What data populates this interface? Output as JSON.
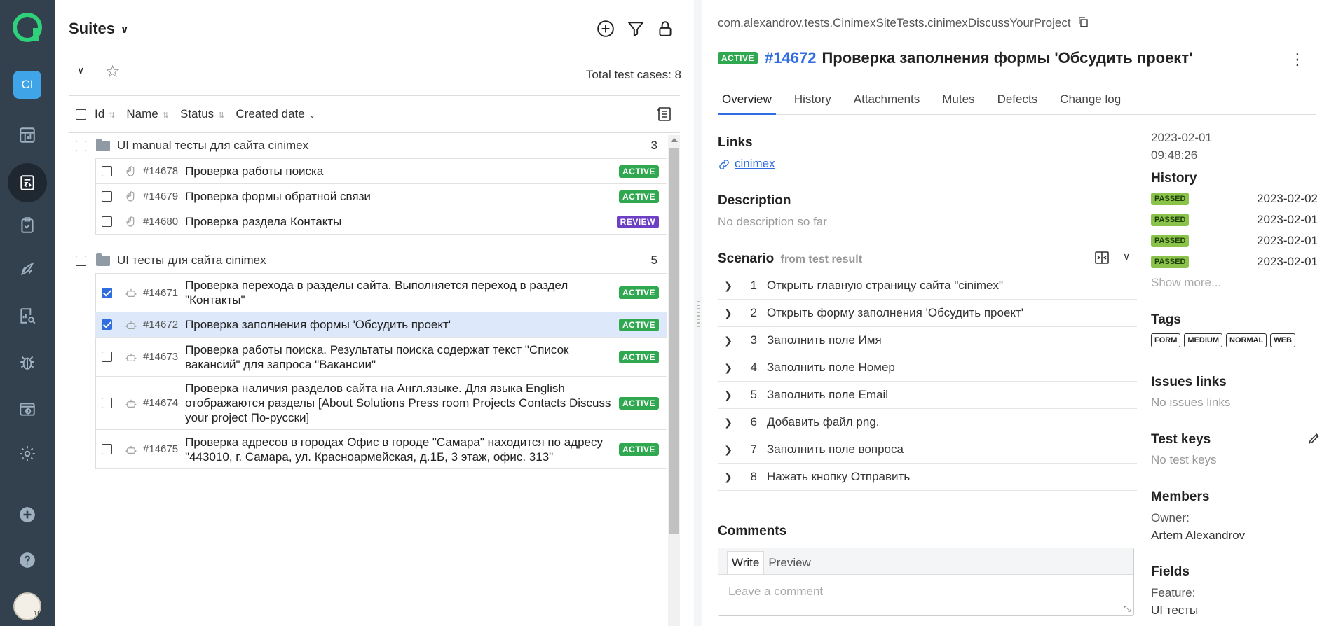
{
  "rail": {
    "project_badge": "CI",
    "avatar_badge": "10"
  },
  "suites": {
    "title": "Suites",
    "total": "Total test cases: 8",
    "columns": {
      "id": "Id",
      "name": "Name",
      "status": "Status",
      "created": "Created date"
    },
    "groups": [
      {
        "name": "UI manual тесты для сайта cinimex",
        "count": "3"
      },
      {
        "name": "UI тесты для сайта cinimex",
        "count": "5"
      }
    ],
    "rows": [
      {
        "id": "#14678",
        "name": "Проверка работы поиска",
        "status": "ACTIVE",
        "kind": "active"
      },
      {
        "id": "#14679",
        "name": "Проверка формы обратной связи",
        "status": "ACTIVE",
        "kind": "active"
      },
      {
        "id": "#14680",
        "name": "Проверка раздела Контакты",
        "status": "REVIEW",
        "kind": "review"
      },
      {
        "id": "#14671",
        "name": "Проверка перехода в разделы сайта. Выполняется переход в раздел \"Контакты\"",
        "status": "ACTIVE",
        "kind": "active"
      },
      {
        "id": "#14672",
        "name": "Проверка заполнения формы 'Обсудить проект'",
        "status": "ACTIVE",
        "kind": "active"
      },
      {
        "id": "#14673",
        "name": "Проверка работы поиска. Результаты поиска содержат текст \"Список вакансий\" для запроса \"Вакансии\"",
        "status": "ACTIVE",
        "kind": "active"
      },
      {
        "id": "#14674",
        "name": "Проверка наличия разделов сайта на Англ.языке. Для языка English отображаются разделы [About Solutions Press room Projects Contacts Discuss your project По-русски]",
        "status": "ACTIVE",
        "kind": "active"
      },
      {
        "id": "#14675",
        "name": "Проверка адресов в городах Офис в городе \"Самара\" находится по адресу \"443010, г. Самара, ул. Красноармейская, д.1Б, 3 этаж, офис. 313\"",
        "status": "ACTIVE",
        "kind": "active"
      }
    ]
  },
  "detail": {
    "path": "com.alexandrov.tests.CinimexSiteTests.cinimexDiscussYourProject",
    "status": "ACTIVE",
    "number": "#14672",
    "title": "Проверка заполнения формы 'Обсудить проект'",
    "tabs": [
      "Overview",
      "History",
      "Attachments",
      "Mutes",
      "Defects",
      "Change log"
    ],
    "links_title": "Links",
    "link_text": "cinimex",
    "description_title": "Description",
    "description_empty": "No description so far",
    "scenario_title": "Scenario",
    "scenario_sub": "from test result",
    "steps": [
      "Открыть главную страницу сайта \"cinimex\"",
      "Открыть форму заполнения 'Обсудить проект'",
      "Заполнить поле Имя",
      "Заполнить поле Номер",
      "Заполнить поле Email",
      "Добавить файл png.",
      "Заполнить поле вопроса",
      "Нажать кнопку Отправить"
    ],
    "step_numbers": [
      "1",
      "2",
      "3",
      "4",
      "5",
      "6",
      "7",
      "8"
    ],
    "comments_title": "Comments",
    "comment_write": "Write",
    "comment_preview": "Preview",
    "comment_placeholder": "Leave a comment"
  },
  "side": {
    "created_date": "2023-02-01",
    "created_time": "09:48:26",
    "history_title": "History",
    "history": [
      {
        "status": "PASSED",
        "date": "2023-02-02"
      },
      {
        "status": "PASSED",
        "date": "2023-02-01"
      },
      {
        "status": "PASSED",
        "date": "2023-02-01"
      },
      {
        "status": "PASSED",
        "date": "2023-02-01"
      }
    ],
    "show_more": "Show more...",
    "tags_title": "Tags",
    "tags": [
      "FORM",
      "MEDIUM",
      "NORMAL",
      "WEB"
    ],
    "issues_title": "Issues links",
    "issues_empty": "No issues links",
    "keys_title": "Test keys",
    "keys_empty": "No test keys",
    "members_title": "Members",
    "owner_label": "Owner:",
    "owner_name": "Artem Alexandrov",
    "fields_title": "Fields",
    "feature_label": "Feature:",
    "feature_value": "UI тесты"
  },
  "colors": {
    "accent": "#2f6de1",
    "active": "#2fa84f",
    "review": "#6d3fc4",
    "passed": "#8bc34a",
    "rail": "#33414e"
  }
}
